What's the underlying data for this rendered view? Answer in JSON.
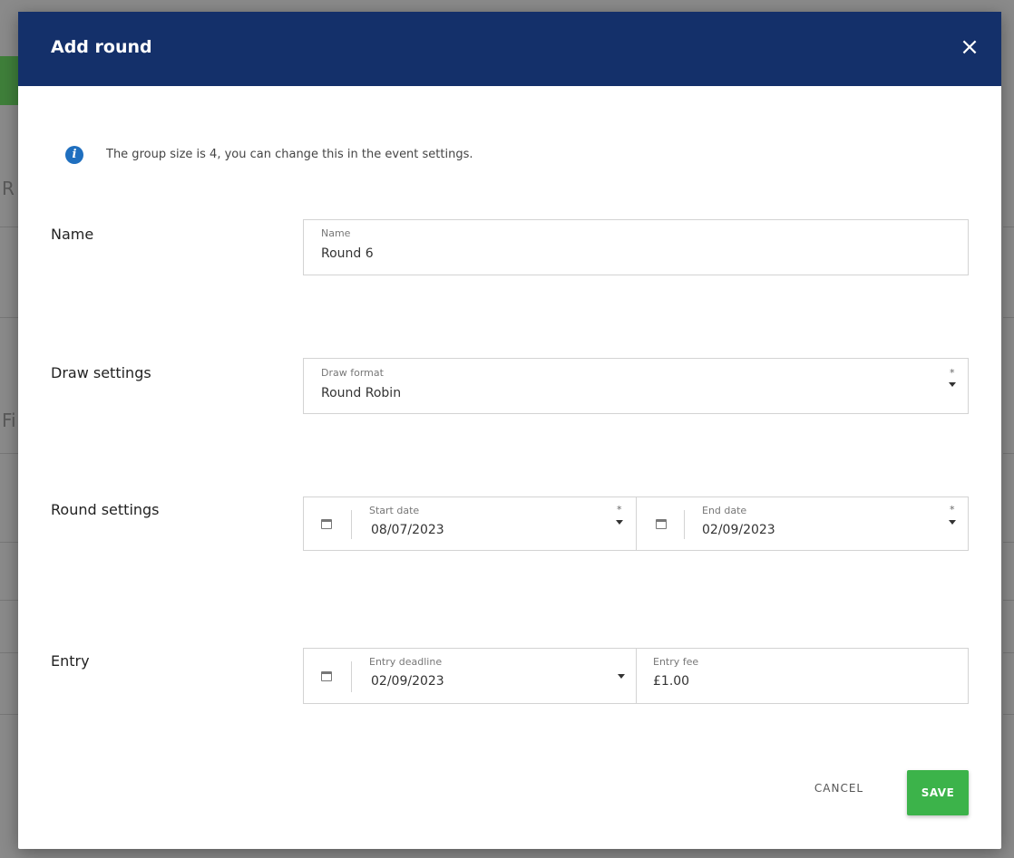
{
  "modal": {
    "title": "Add round",
    "close_glyph": "×",
    "info_text": "The group size is 4, you can change this in the event settings.",
    "info_glyph": "i"
  },
  "name_row": {
    "label": "Name",
    "field_label": "Name",
    "value": "Round 6"
  },
  "draw_row": {
    "label": "Draw settings",
    "field_label": "Draw format",
    "value": "Round Robin",
    "required": "*"
  },
  "round_row": {
    "label": "Round settings",
    "start_label": "Start date",
    "start_value": "08/07/2023",
    "end_label": "End date",
    "end_value": "02/09/2023",
    "required": "*"
  },
  "entry_row": {
    "label": "Entry",
    "deadline_label": "Entry deadline",
    "deadline_value": "02/09/2023",
    "fee_label": "Entry fee",
    "fee_value": "£1.00"
  },
  "buttons": {
    "cancel": "CANCEL",
    "save": "SAVE"
  },
  "colors": {
    "header": "#14306a",
    "save": "#3cb34a",
    "info": "#1f6fbf"
  }
}
